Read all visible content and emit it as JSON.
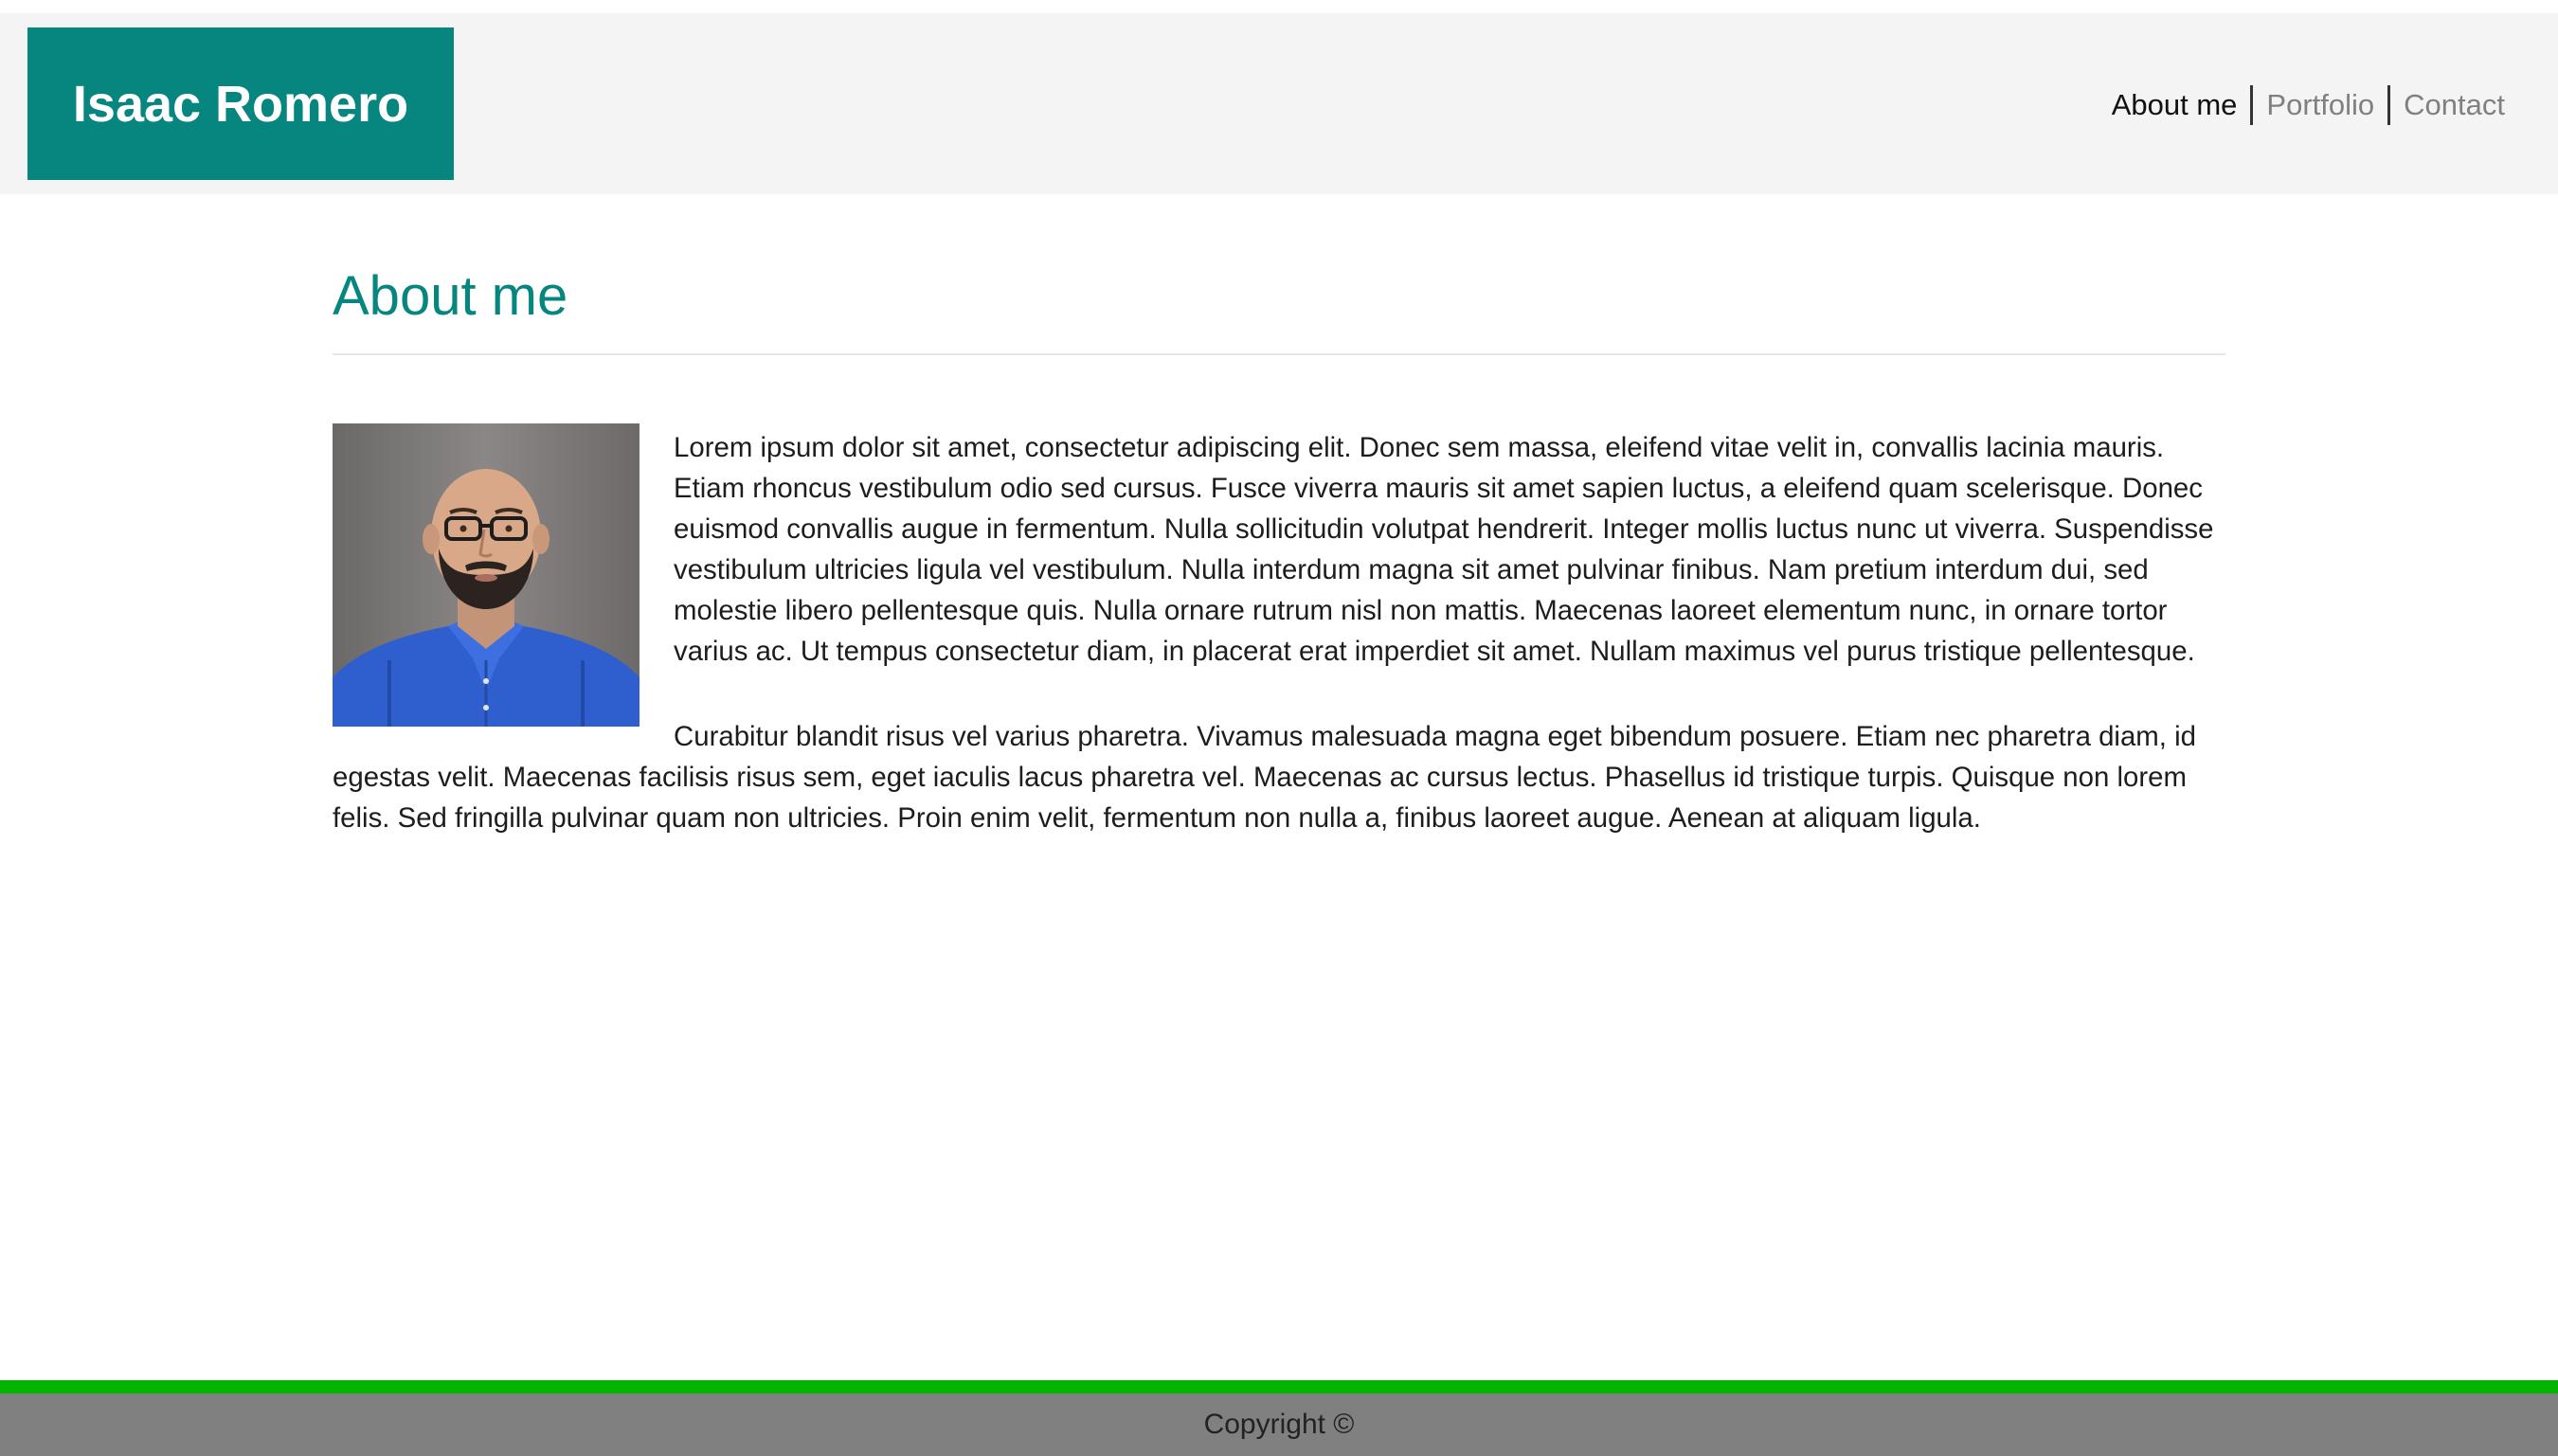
{
  "header": {
    "brand": "Isaac Romero",
    "brand_color": "#07857f",
    "nav": [
      {
        "label": "About me",
        "active": true
      },
      {
        "label": "Portfolio",
        "active": false
      },
      {
        "label": "Contact",
        "active": false
      }
    ]
  },
  "main": {
    "title": "About me",
    "photo": "profile-photo",
    "paragraphs": [
      "Lorem ipsum dolor sit amet, consectetur adipiscing elit. Donec sem massa, eleifend vitae velit in, convallis lacinia mauris. Etiam rhoncus vestibulum odio sed cursus. Fusce viverra mauris sit amet sapien luctus, a eleifend quam scelerisque. Donec euismod convallis augue in fermentum. Nulla sollicitudin volutpat hendrerit. Integer mollis luctus nunc ut viverra. Suspendisse vestibulum ultricies ligula vel vestibulum. Nulla interdum magna sit amet pulvinar finibus. Nam pretium interdum dui, sed molestie libero pellentesque quis. Nulla ornare rutrum nisl non mattis. Maecenas laoreet elementum nunc, in ornare tortor varius ac. Ut tempus consectetur diam, in placerat erat imperdiet sit amet. Nullam maximus vel purus tristique pellentesque.",
      "Curabitur blandit risus vel varius pharetra. Vivamus malesuada magna eget bibendum posuere. Etiam nec pharetra diam, id egestas velit. Maecenas facilisis risus sem, eget iaculis lacus pharetra vel. Maecenas ac cursus lectus. Phasellus id tristique turpis. Quisque non lorem felis. Sed fringilla pulvinar quam non ultricies. Proin enim velit, fermentum non nulla a, finibus laoreet augue. Aenean at aliquam ligula."
    ]
  },
  "footer": {
    "copyright": "Copyright ©",
    "accent_color": "#00b400"
  }
}
